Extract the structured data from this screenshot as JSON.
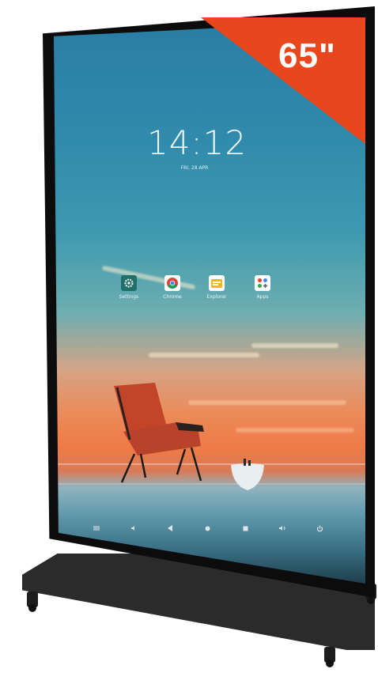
{
  "product": {
    "size_badge": "65\"",
    "badge_color": "#e8461c",
    "frame_color": "#0c0c0c",
    "stand_color": "#2b2b2b"
  },
  "lockscreen": {
    "time": "14:12",
    "date": "FRI, 28 APR"
  },
  "apps": [
    {
      "label": "Settings",
      "icon": "gear-icon",
      "color": "#1f6f6a"
    },
    {
      "label": "Chrome",
      "icon": "chrome-icon",
      "color": "#ffffff"
    },
    {
      "label": "Explorer",
      "icon": "folder-icon",
      "color": "#f3b51c"
    },
    {
      "label": "Apps",
      "icon": "apps-grid-icon",
      "color": "#ffffff"
    }
  ],
  "navbar": [
    "menu-icon",
    "volume-down-icon",
    "back-icon",
    "home-icon",
    "recents-icon",
    "volume-up-icon",
    "power-icon"
  ]
}
